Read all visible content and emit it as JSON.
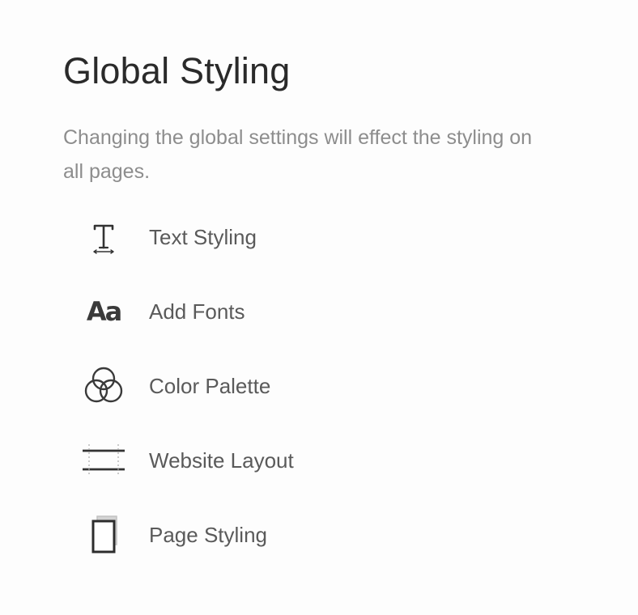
{
  "panel": {
    "title": "Global Styling",
    "description": "Changing the global settings will effect the styling on all pages."
  },
  "menu": {
    "items": [
      {
        "label": "Text Styling",
        "icon": "text-styling-icon"
      },
      {
        "label": "Add Fonts",
        "icon": "add-fonts-icon",
        "glyph": "Aa"
      },
      {
        "label": "Color Palette",
        "icon": "color-palette-icon"
      },
      {
        "label": "Website Layout",
        "icon": "website-layout-icon"
      },
      {
        "label": "Page Styling",
        "icon": "page-styling-icon"
      }
    ]
  }
}
